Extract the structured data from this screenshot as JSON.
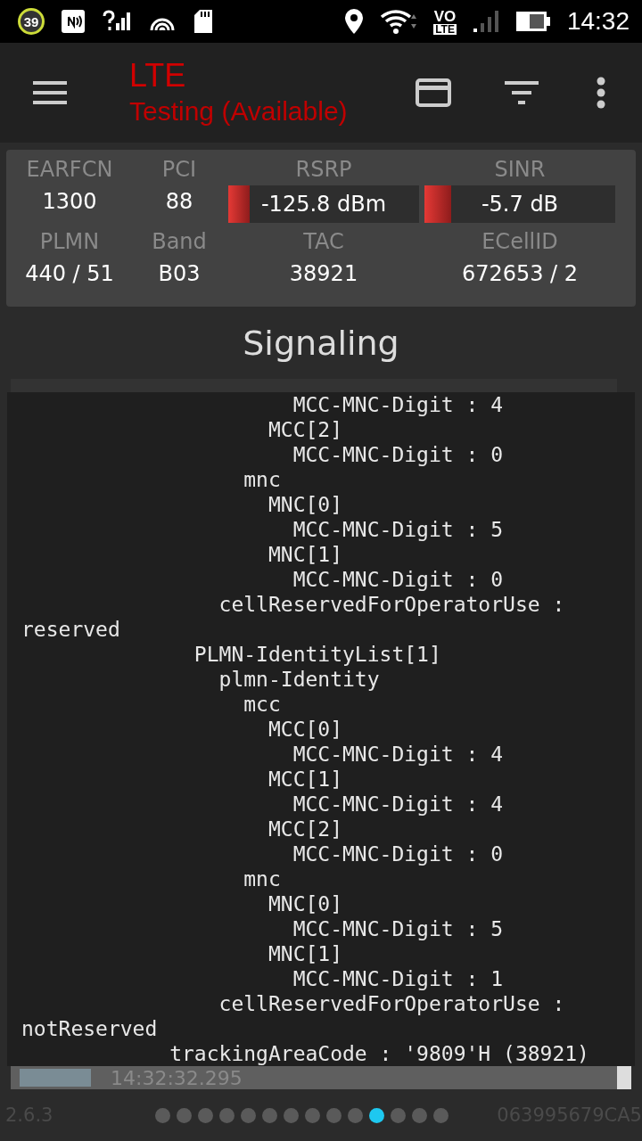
{
  "status_bar": {
    "badge": "39",
    "volte_top": "VO",
    "volte_bottom": "LTE",
    "time": "14:32"
  },
  "toolbar": {
    "title": "LTE",
    "subtitle": "Testing (Available)"
  },
  "info_cells": [
    {
      "kind": "text",
      "label": "EARFCN",
      "value": "1300"
    },
    {
      "kind": "text",
      "label": "PCI",
      "value": "88"
    },
    {
      "kind": "meter",
      "label": "RSRP",
      "value": "-125.8 dBm",
      "level": 0.11
    },
    {
      "kind": "meter",
      "label": "SINR",
      "value": "-5.7 dB",
      "level": 0.14
    },
    {
      "kind": "text",
      "label": "PLMN",
      "value": "440 / 51"
    },
    {
      "kind": "text",
      "label": "Band",
      "value": "B03"
    },
    {
      "kind": "text",
      "label": "TAC",
      "value": "38921"
    },
    {
      "kind": "text",
      "label": "ECellID",
      "value": "672653 / 2"
    }
  ],
  "section_title": "Signaling",
  "detail_lines": [
    "                      MCC-MNC-Digit : 4",
    "                    MCC[2]",
    "                      MCC-MNC-Digit : 0",
    "                  mnc",
    "                    MNC[0]",
    "                      MCC-MNC-Digit : 5",
    "                    MNC[1]",
    "                      MCC-MNC-Digit : 0",
    "                cellReservedForOperatorUse :",
    "reserved",
    "              PLMN-IdentityList[1]",
    "                plmn-Identity",
    "                  mcc",
    "                    MCC[0]",
    "                      MCC-MNC-Digit : 4",
    "                    MCC[1]",
    "                      MCC-MNC-Digit : 4",
    "                    MCC[2]",
    "                      MCC-MNC-Digit : 0",
    "                  mnc",
    "                    MNC[0]",
    "                      MCC-MNC-Digit : 5",
    "                    MNC[1]",
    "                      MCC-MNC-Digit : 1",
    "                cellReservedForOperatorUse :",
    "notReserved",
    "            trackingAreaCode : '9809'H (38921)"
  ],
  "last_row": {
    "time": "14:32:32.295"
  },
  "footer": {
    "version": "2.6.3",
    "device_id": "063995679CA5",
    "pages": [
      {
        "selected": false
      },
      {
        "selected": false
      },
      {
        "selected": false
      },
      {
        "selected": false
      },
      {
        "selected": false
      },
      {
        "selected": false
      },
      {
        "selected": false
      },
      {
        "selected": false
      },
      {
        "selected": false
      },
      {
        "selected": false
      },
      {
        "selected": true
      },
      {
        "selected": false
      },
      {
        "selected": false
      },
      {
        "selected": false
      }
    ]
  }
}
